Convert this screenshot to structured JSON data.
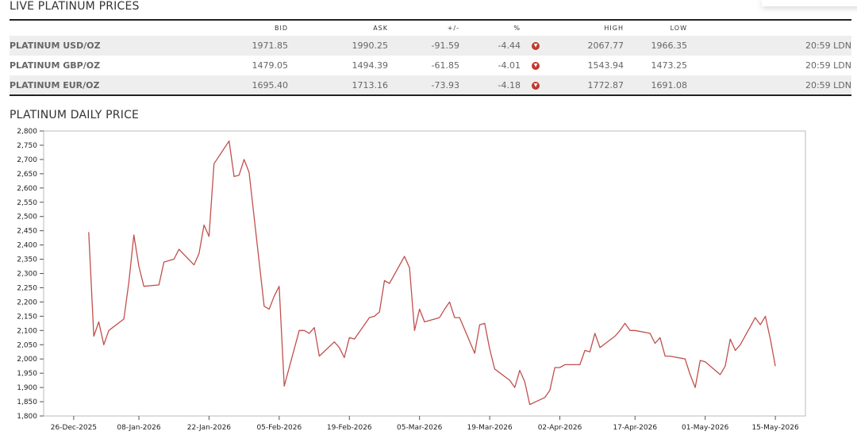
{
  "live_title": "LIVE PLATINUM PRICES",
  "chart_title": "PLATINUM DAILY PRICE",
  "table": {
    "headers": [
      "",
      "BID",
      "ASK",
      "+/-",
      "%",
      "",
      "HIGH",
      "LOW",
      ""
    ],
    "rows": [
      {
        "metal": "PLATINUM USD/OZ",
        "bid": "1971.85",
        "ask": "1990.25",
        "change": "-91.59",
        "pct": "-4.44",
        "high": "2067.77",
        "low": "1966.35",
        "time": "20:59 LDN"
      },
      {
        "metal": "PLATINUM GBP/OZ",
        "bid": "1479.05",
        "ask": "1494.39",
        "change": "-61.85",
        "pct": "-4.01",
        "high": "1543.94",
        "low": "1473.25",
        "time": "20:59 LDN"
      },
      {
        "metal": "PLATINUM EUR/OZ",
        "bid": "1695.40",
        "ask": "1713.16",
        "change": "-73.93",
        "pct": "-4.18",
        "high": "1772.87",
        "low": "1691.08",
        "time": "20:59 LDN"
      }
    ],
    "down_icon": "arrow-down-circle-icon"
  },
  "colors": {
    "line": "#c0504d",
    "negative": "#c0392b",
    "grid_border": "#bbbbbb"
  },
  "chart_data": {
    "type": "line",
    "title": "",
    "xlabel": "",
    "ylabel": "",
    "ylim": [
      1800,
      2800
    ],
    "yticks": [
      "1,800",
      "1,850",
      "1,900",
      "1,950",
      "2,000",
      "2,050",
      "2,100",
      "2,150",
      "2,200",
      "2,250",
      "2,300",
      "2,350",
      "2,400",
      "2,450",
      "2,500",
      "2,550",
      "2,600",
      "2,650",
      "2,700",
      "2,750",
      "2,800"
    ],
    "xticks": [
      "26-Dec-2025",
      "08-Jan-2026",
      "22-Jan-2026",
      "05-Feb-2026",
      "19-Feb-2026",
      "05-Mar-2026",
      "19-Mar-2026",
      "02-Apr-2026",
      "17-Apr-2026",
      "01-May-2026",
      "15-May-2026"
    ],
    "series": [
      {
        "name": "",
        "points": [
          [
            "2025-12-29",
            2445
          ],
          [
            "2025-12-30",
            2080
          ],
          [
            "2025-12-31",
            2130
          ],
          [
            "2026-01-01",
            2050
          ],
          [
            "2026-01-02",
            2100
          ],
          [
            "2026-01-05",
            2140
          ],
          [
            "2026-01-06",
            2270
          ],
          [
            "2026-01-07",
            2435
          ],
          [
            "2026-01-08",
            2325
          ],
          [
            "2026-01-09",
            2255
          ],
          [
            "2026-01-12",
            2260
          ],
          [
            "2026-01-13",
            2340
          ],
          [
            "2026-01-14",
            2345
          ],
          [
            "2026-01-15",
            2350
          ],
          [
            "2026-01-16",
            2385
          ],
          [
            "2026-01-19",
            2330
          ],
          [
            "2026-01-20",
            2370
          ],
          [
            "2026-01-21",
            2470
          ],
          [
            "2026-01-22",
            2430
          ],
          [
            "2026-01-23",
            2685
          ],
          [
            "2026-01-26",
            2765
          ],
          [
            "2026-01-27",
            2640
          ],
          [
            "2026-01-28",
            2645
          ],
          [
            "2026-01-29",
            2700
          ],
          [
            "2026-01-30",
            2655
          ],
          [
            "2026-02-02",
            2185
          ],
          [
            "2026-02-03",
            2175
          ],
          [
            "2026-02-04",
            2220
          ],
          [
            "2026-02-05",
            2255
          ],
          [
            "2026-02-06",
            1905
          ],
          [
            "2026-02-09",
            2100
          ],
          [
            "2026-02-10",
            2100
          ],
          [
            "2026-02-11",
            2090
          ],
          [
            "2026-02-12",
            2110
          ],
          [
            "2026-02-13",
            2010
          ],
          [
            "2026-02-16",
            2060
          ],
          [
            "2026-02-17",
            2040
          ],
          [
            "2026-02-18",
            2005
          ],
          [
            "2026-02-19",
            2075
          ],
          [
            "2026-02-20",
            2070
          ],
          [
            "2026-02-23",
            2145
          ],
          [
            "2026-02-24",
            2150
          ],
          [
            "2026-02-25",
            2165
          ],
          [
            "2026-02-26",
            2275
          ],
          [
            "2026-02-27",
            2265
          ],
          [
            "2026-03-02",
            2360
          ],
          [
            "2026-03-03",
            2320
          ],
          [
            "2026-03-04",
            2100
          ],
          [
            "2026-03-05",
            2175
          ],
          [
            "2026-03-06",
            2130
          ],
          [
            "2026-03-09",
            2145
          ],
          [
            "2026-03-10",
            2175
          ],
          [
            "2026-03-11",
            2200
          ],
          [
            "2026-03-12",
            2145
          ],
          [
            "2026-03-13",
            2145
          ],
          [
            "2026-03-16",
            2020
          ],
          [
            "2026-03-17",
            2120
          ],
          [
            "2026-03-18",
            2125
          ],
          [
            "2026-03-19",
            2035
          ],
          [
            "2026-03-20",
            1965
          ],
          [
            "2026-03-23",
            1925
          ],
          [
            "2026-03-24",
            1900
          ],
          [
            "2026-03-25",
            1960
          ],
          [
            "2026-03-26",
            1920
          ],
          [
            "2026-03-27",
            1840
          ],
          [
            "2026-03-30",
            1865
          ],
          [
            "2026-03-31",
            1890
          ],
          [
            "2026-04-01",
            1970
          ],
          [
            "2026-04-02",
            1970
          ],
          [
            "2026-04-03",
            1980
          ],
          [
            "2026-04-06",
            1980
          ],
          [
            "2026-04-07",
            2030
          ],
          [
            "2026-04-08",
            2025
          ],
          [
            "2026-04-09",
            2090
          ],
          [
            "2026-04-10",
            2040
          ],
          [
            "2026-04-13",
            2080
          ],
          [
            "2026-04-14",
            2100
          ],
          [
            "2026-04-15",
            2125
          ],
          [
            "2026-04-16",
            2100
          ],
          [
            "2026-04-17",
            2100
          ],
          [
            "2026-04-20",
            2090
          ],
          [
            "2026-04-21",
            2055
          ],
          [
            "2026-04-22",
            2075
          ],
          [
            "2026-04-23",
            2010
          ],
          [
            "2026-04-24",
            2010
          ],
          [
            "2026-04-27",
            2000
          ],
          [
            "2026-04-28",
            1945
          ],
          [
            "2026-04-29",
            1900
          ],
          [
            "2026-04-30",
            1995
          ],
          [
            "2026-05-01",
            1990
          ],
          [
            "2026-05-04",
            1945
          ],
          [
            "2026-05-05",
            1975
          ],
          [
            "2026-05-06",
            2070
          ],
          [
            "2026-05-07",
            2030
          ],
          [
            "2026-05-08",
            2050
          ],
          [
            "2026-05-11",
            2145
          ],
          [
            "2026-05-12",
            2120
          ],
          [
            "2026-05-13",
            2150
          ],
          [
            "2026-05-14",
            2070
          ],
          [
            "2026-05-15",
            1975
          ]
        ]
      }
    ],
    "grid": false,
    "legend": "none"
  }
}
